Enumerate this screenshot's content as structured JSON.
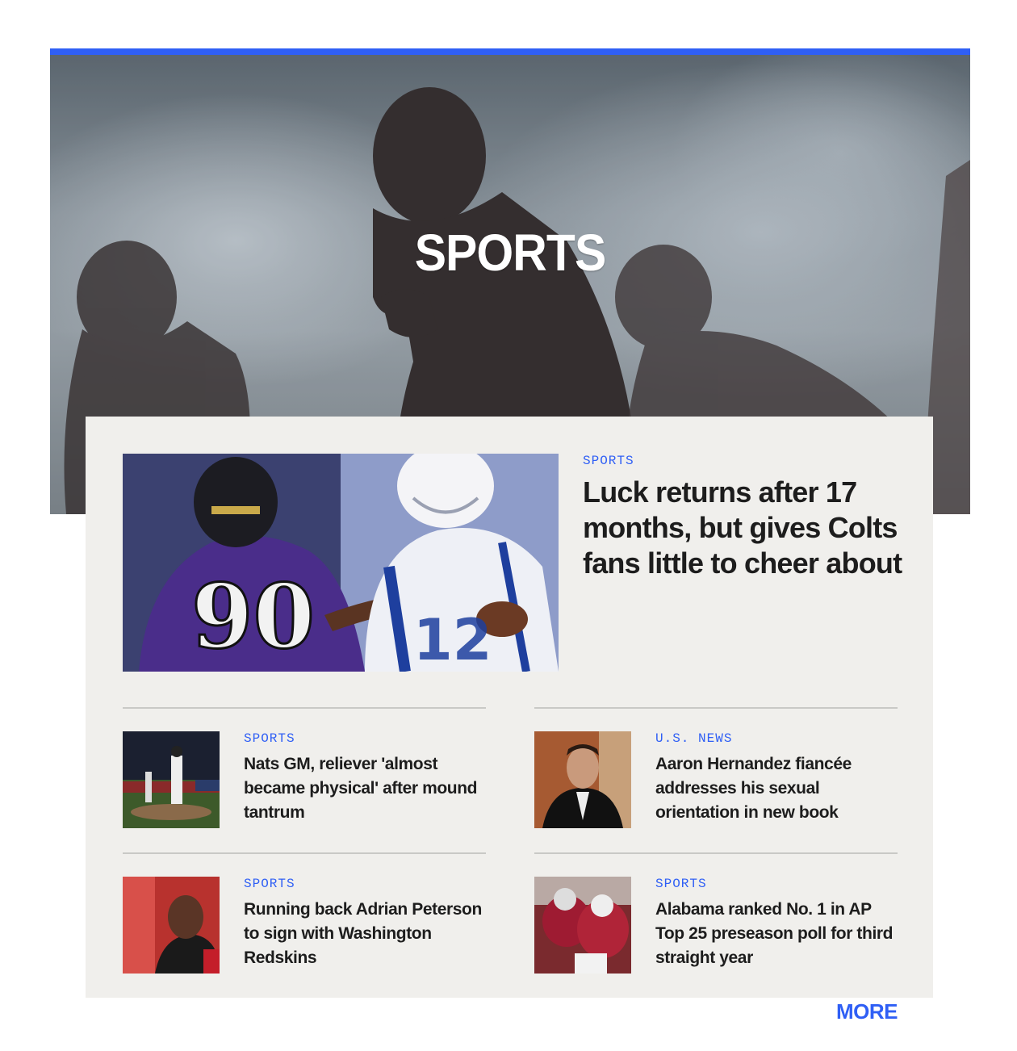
{
  "section": {
    "title": "SPORTS",
    "accent_color": "#2f5ff5",
    "hero_image": "football-players-in-smoke-tunnel"
  },
  "featured": {
    "kicker": "SPORTS",
    "headline": "Luck returns after 17 months, but gives Colts fans little to cheer about",
    "image": "ravens-90-vs-colts-12-photo"
  },
  "stories": [
    {
      "kicker": "SPORTS",
      "headline": "Nats GM, reliever 'almost became physical' after mound tantrum",
      "image": "nationals-pitcher-on-mound-photo"
    },
    {
      "kicker": "U.S. NEWS",
      "headline": "Aaron Hernandez fiancée addresses his sexual orientation in new book",
      "image": "man-in-suit-courtroom-photo"
    },
    {
      "kicker": "SPORTS",
      "headline": "Running back Adrian Peterson to sign with Washington Redskins",
      "image": "running-back-in-red-jersey-photo"
    },
    {
      "kicker": "SPORTS",
      "headline": "Alabama ranked No. 1 in AP Top 25 preseason poll for third straight year",
      "image": "alabama-players-celebrating-photo"
    }
  ],
  "more_label": "MORE"
}
